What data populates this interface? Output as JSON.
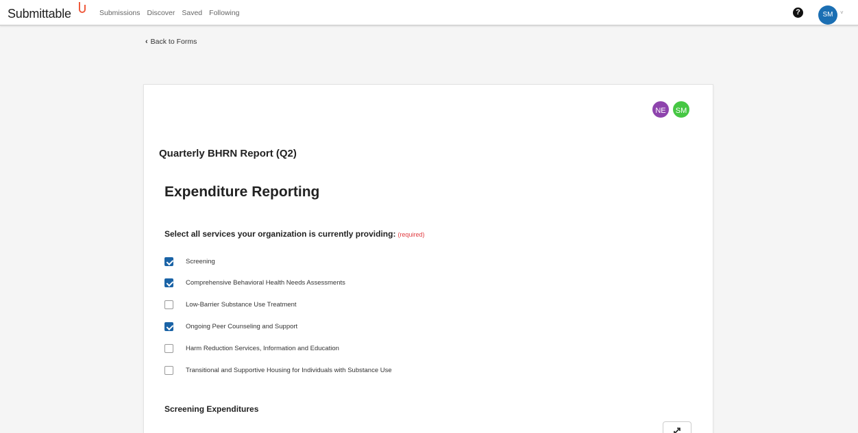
{
  "app": {
    "logo_text": "Submittable"
  },
  "nav": {
    "items": [
      "Submissions",
      "Discover",
      "Saved",
      "Following"
    ]
  },
  "header": {
    "help": "?",
    "user_initials": "SM",
    "user_chevron": "˅"
  },
  "back": {
    "label": "Back to Forms"
  },
  "form": {
    "collaborators": [
      "NE",
      "SM"
    ],
    "title": "Quarterly BHRN Report (Q2)",
    "section_title": "Expenditure Reporting",
    "question": "Select all services your organization is currently providing:",
    "required_label": "(required)",
    "options": [
      {
        "label": "Screening",
        "checked": true
      },
      {
        "label": "Comprehensive Behavioral Health Needs Assessments",
        "checked": true
      },
      {
        "label": "Low-Barrier Substance Use Treatment",
        "checked": false
      },
      {
        "label": "Ongoing Peer Counseling and Support",
        "checked": true
      },
      {
        "label": "Harm Reduction Services, Information and Education",
        "checked": false
      },
      {
        "label": "Transitional and Supportive Housing for Individuals with Substance Use",
        "checked": false
      }
    ],
    "subsection_title": "Screening Expenditures"
  },
  "colors": {
    "brand_accent": "#ef5a3c",
    "checkbox_checked": "#1a63a6",
    "user_avatar": "#1b6fb3",
    "collab_ne": "#8e44ad",
    "collab_sm": "#46c743",
    "required": "#e0393e"
  }
}
